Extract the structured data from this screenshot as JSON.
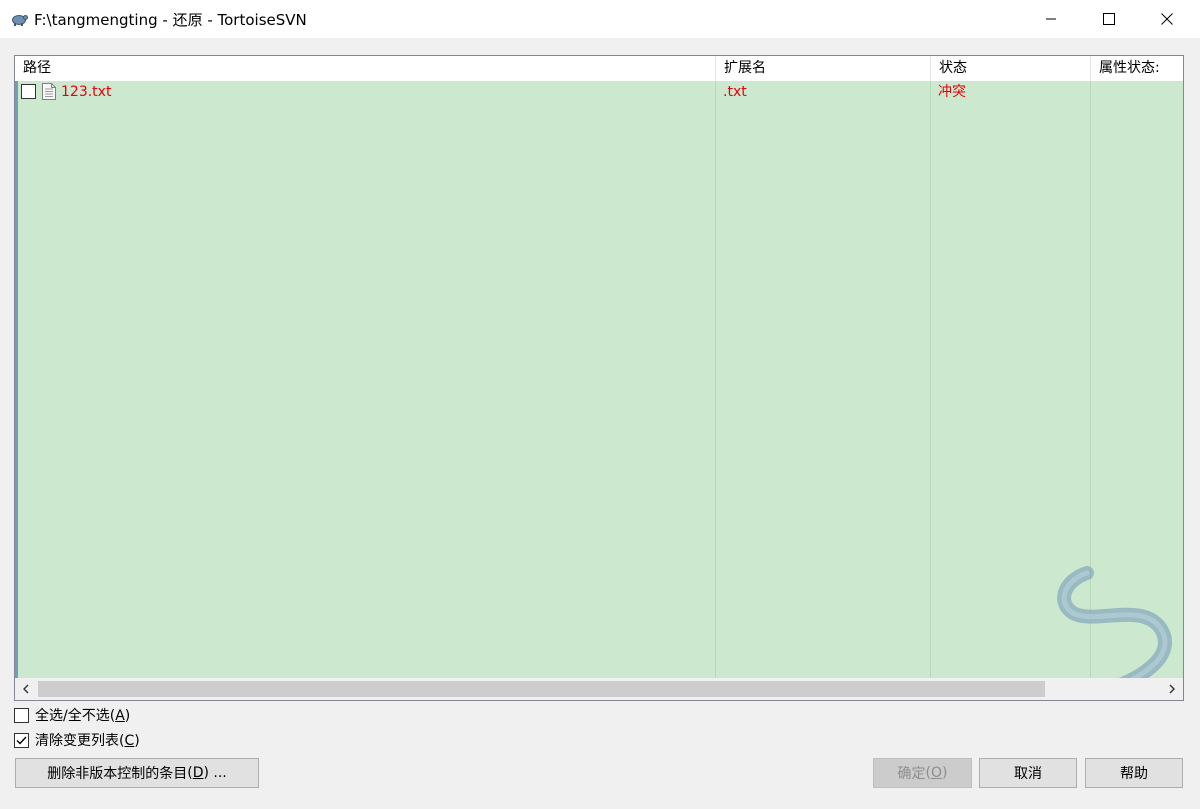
{
  "window": {
    "title": "F:\\tangmengting - 还原 - TortoiseSVN",
    "minimize_icon": "minimize-icon",
    "maximize_icon": "maximize-icon",
    "close_icon": "close-icon"
  },
  "list": {
    "columns": [
      {
        "label": "路径"
      },
      {
        "label": "扩展名"
      },
      {
        "label": "状态"
      },
      {
        "label": "属性状态:"
      }
    ],
    "rows": [
      {
        "checked": false,
        "path": "123.txt",
        "extension": ".txt",
        "status": "冲突",
        "property_status": ""
      }
    ],
    "row_text_color": "#e8000b",
    "background_color": "#cce8cf"
  },
  "options": {
    "select_all_label": "全选/全不选",
    "select_all_key": "A",
    "select_all_checked": false,
    "clear_changelist_label": "清除变更列表",
    "clear_changelist_key": "C",
    "clear_changelist_checked": true
  },
  "buttons": {
    "delete_unversioned_label": "删除非版本控制的条目",
    "delete_unversioned_key": "D",
    "delete_unversioned_suffix": " ...",
    "ok_label": "确定",
    "ok_key": "O",
    "ok_enabled": false,
    "cancel_label": "取消",
    "help_label": "帮助"
  }
}
